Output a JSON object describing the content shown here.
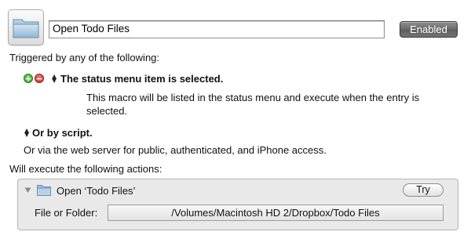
{
  "macro": {
    "name": "Open Todo Files",
    "enabled_label": "Enabled",
    "icon": "folder-icon"
  },
  "triggers": {
    "heading": "Triggered by any of the following:",
    "status_menu_trigger": "The status menu item is selected.",
    "status_menu_description_line1": "This macro will be listed in the status menu and execute when the entry is",
    "status_menu_description_line2": "selected.",
    "script_trigger": "Or by script.",
    "web_server_note": "Or via the web server for public, authenticated, and iPhone access."
  },
  "actions": {
    "heading": "Will execute the following actions:",
    "items": [
      {
        "title": "Open ‘Todo Files’",
        "try_label": "Try",
        "field_label": "File or Folder:",
        "path": "/Volumes/Macintosh HD 2/Dropbox/Todo Files"
      }
    ]
  },
  "colors": {
    "add_button": "#2f9a1e",
    "remove_button": "#c22a2a",
    "enabled_button": "#6a6a6a"
  }
}
